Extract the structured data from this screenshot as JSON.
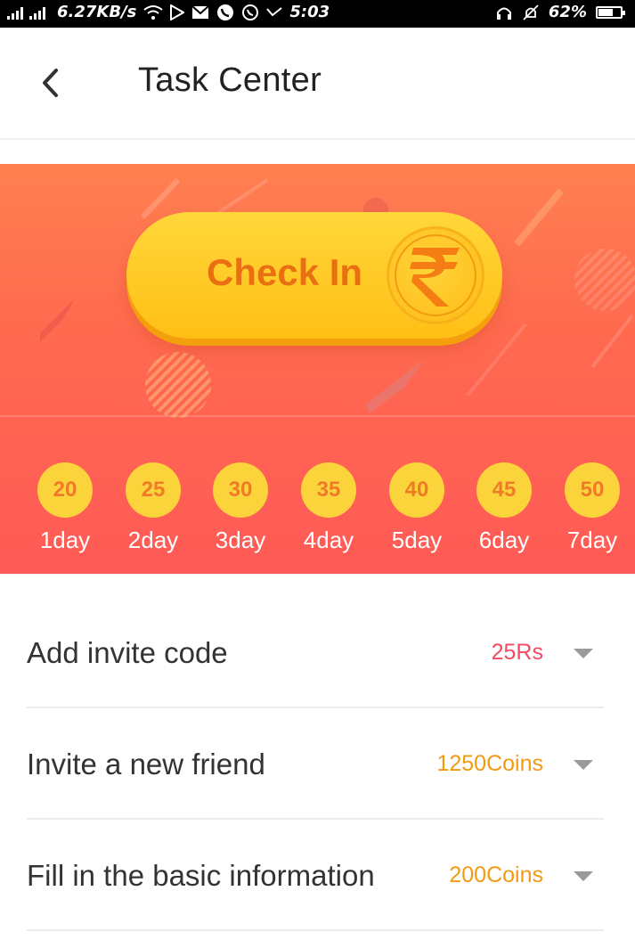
{
  "status_bar": {
    "net_speed": "6.27KB/s",
    "time": "5:03",
    "battery": "62%",
    "battery_level": 0.62
  },
  "header": {
    "title": "Task Center"
  },
  "banner": {
    "checkin_label": "Check In",
    "coin_symbol": "₹",
    "days": [
      {
        "value": "20",
        "label": "1day"
      },
      {
        "value": "25",
        "label": "2day"
      },
      {
        "value": "30",
        "label": "3day"
      },
      {
        "value": "35",
        "label": "4day"
      },
      {
        "value": "40",
        "label": "5day"
      },
      {
        "value": "45",
        "label": "6day"
      },
      {
        "value": "50",
        "label": "7day"
      }
    ]
  },
  "tasks": [
    {
      "title": "Add invite code",
      "reward": "25Rs",
      "reward_color": "#f14b62"
    },
    {
      "title": "Invite a new friend",
      "reward": "1250Coins",
      "reward_color": "#f19a12"
    },
    {
      "title": "Fill in the basic information",
      "reward": "200Coins",
      "reward_color": "#f19a12"
    }
  ],
  "colors": {
    "banner_top": "#ff8050",
    "banner_bottom": "#ff5a57",
    "button_yellow": "#ffc21f",
    "checkin_text": "#ea6e12",
    "day_circle": "#fbd43c"
  }
}
